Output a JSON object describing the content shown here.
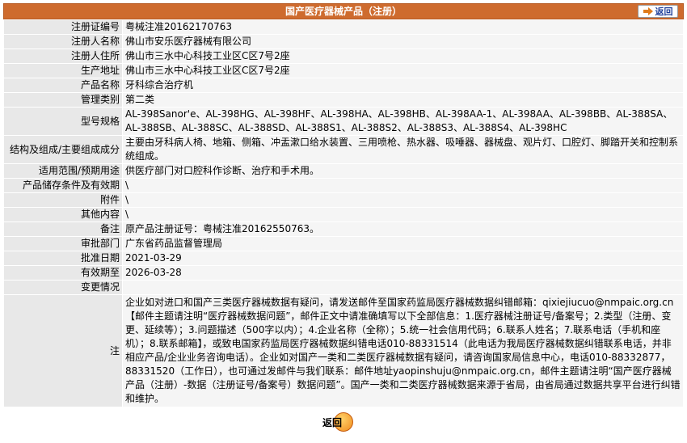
{
  "header": {
    "title": "国产医疗器械产品（注册）",
    "back_label": "返回"
  },
  "rows": [
    {
      "label": "注册证编号",
      "value": "粤械注准20162170763"
    },
    {
      "label": "注册人名称",
      "value": "佛山市安乐医疗器械有限公司"
    },
    {
      "label": "注册人住所",
      "value": "佛山市三水中心科技工业区C区7号2座"
    },
    {
      "label": "生产地址",
      "value": "佛山市三水中心科技工业区C区7号2座"
    },
    {
      "label": "产品名称",
      "value": "牙科综合治疗机"
    },
    {
      "label": "管理类别",
      "value": "第二类"
    },
    {
      "label": "型号规格",
      "value": "AL-398Sanor'e、AL-398HG、AL-398HF、AL-398HA、AL-398HB、AL-398AA-1、AL-398AA、AL-398BB、AL-388SA、AL-388SB、AL-388SC、AL-388SD、AL-388S1、AL-388S2、AL-388S3、AL-388S4、AL-398HC"
    },
    {
      "label": "结构及组成/主要组成成分",
      "value": "主要由牙科病人椅、地箱、侧箱、冲盂漱口给水装置、三用喷枪、热水器、吸唾器、器械盘、观片灯、口腔灯、脚踏开关和控制系统组成。"
    },
    {
      "label": "适用范围/预期用途",
      "value": "供医疗部门对口腔科作诊断、治疗和手术用。"
    },
    {
      "label": "产品储存条件及有效期",
      "value": "\\"
    },
    {
      "label": "附件",
      "value": "\\"
    },
    {
      "label": "其他内容",
      "value": "\\"
    },
    {
      "label": "备注",
      "value": "原产品注册证号：粤械注准20162550763。"
    },
    {
      "label": "审批部门",
      "value": "广东省药品监督管理局"
    },
    {
      "label": "批准日期",
      "value": "2021-03-29"
    },
    {
      "label": "有效期至",
      "value": "2026-03-28"
    },
    {
      "label": "变更情况",
      "value": ""
    }
  ],
  "note": {
    "label": "注",
    "text": "企业如对进口和国产三类医疗器械数据有疑问，请发送邮件至国家药监局医疗器械数据纠错邮箱：qixiejiucuo@nmpaic.org.cn【邮件主题请注明“医疗器械数据问题”，邮件正文中请准确填写以下全部信息：1.医疗器械注册证号/备案号；2.类型（注册、变更、延续等）；3.问题描述（500字以内）；4.企业名称（全称）；5.统一社会信用代码；6.联系人姓名；7.联系电话（手机和座机）；8.联系邮箱】，或致电国家药监局医疗器械数据纠错电话010-88331514（此电话为我局医疗器械数据纠错联系电话，并非相应产品/企业业务咨询电话）。企业如对国产一类和二类医疗器械数据有疑问，请咨询国家局信息中心，电话010-88332877，88331520（工作日），也可通过发邮件与我们联系：邮件地址yaopinshuju@nmpaic.org.cn，邮件主题请注明“国产医疗器械产品（注册）-数据（注册证号/备案号）数据问题”。国产一类和二类医疗器械数据来源于省局，由省局通过数据共享平台进行纠错和维护。"
  },
  "footer": {
    "back_label": "返回"
  }
}
